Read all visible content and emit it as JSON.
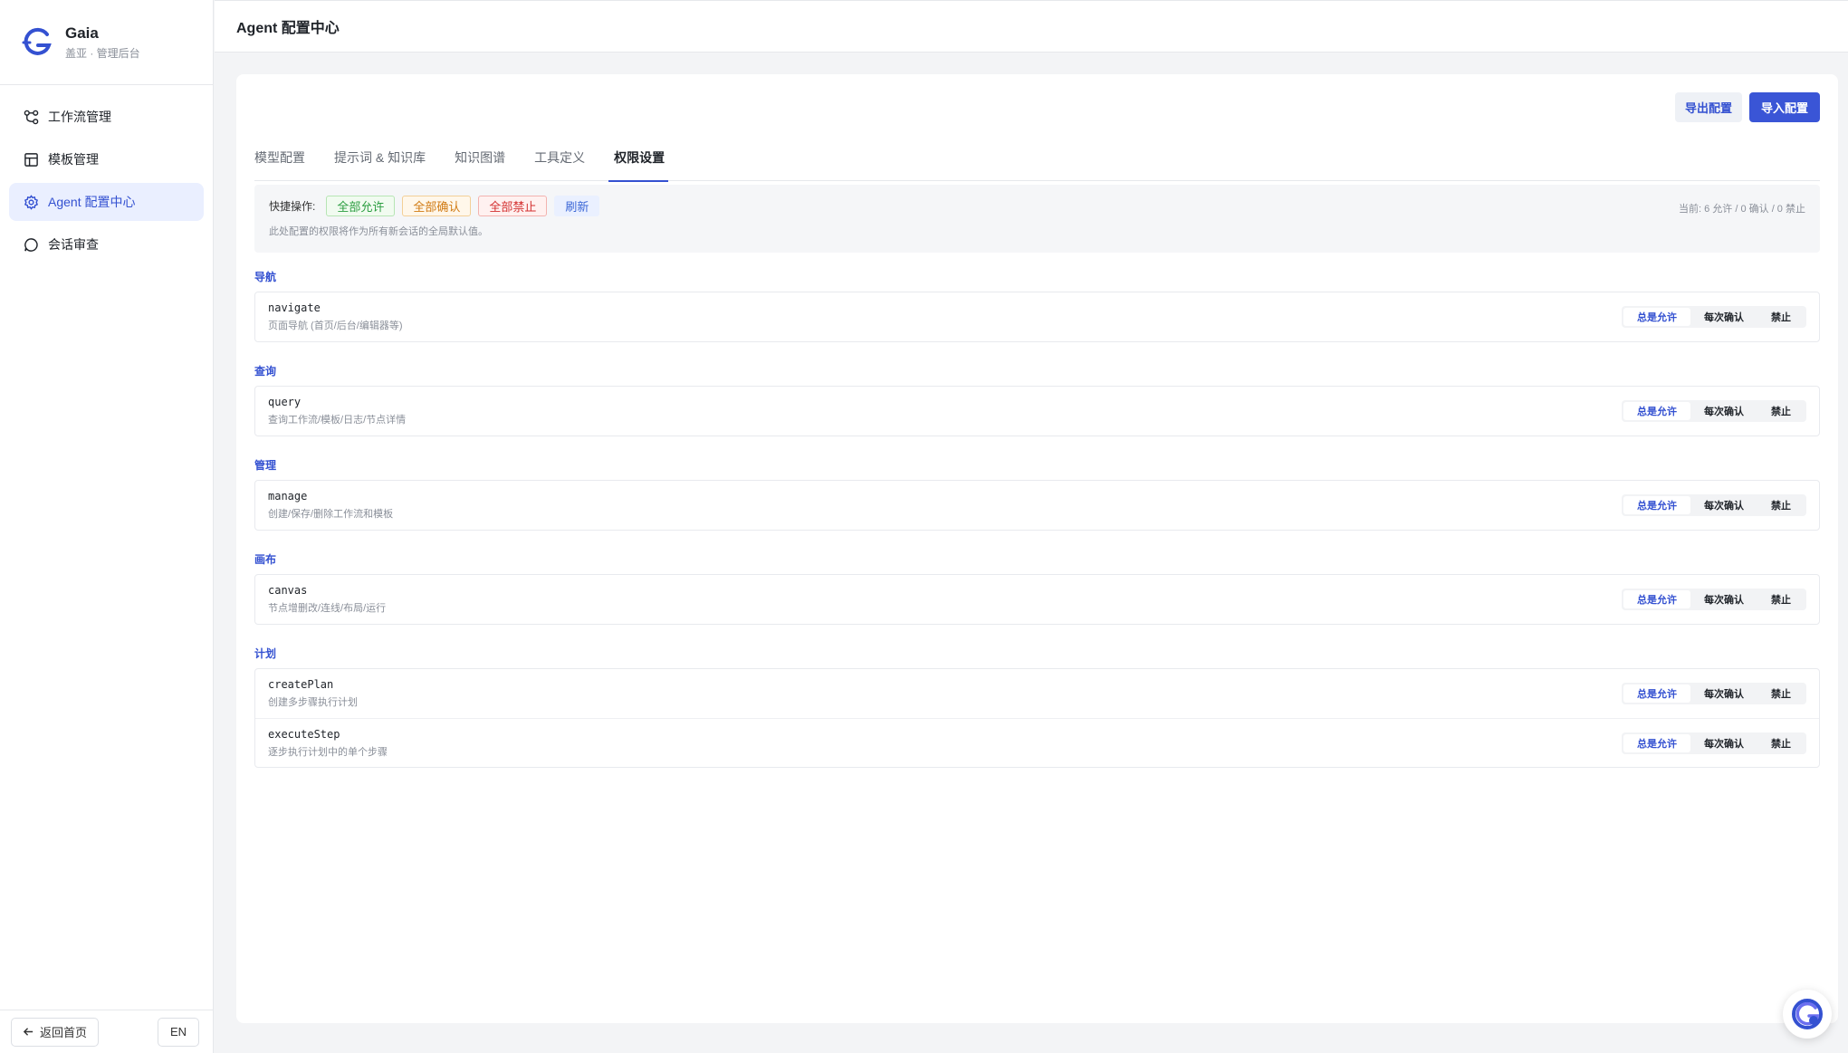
{
  "brand": {
    "name": "Gaia",
    "subtitle": "盖亚 · 管理后台",
    "logo_icon": "gaia-logo-icon"
  },
  "nav": [
    {
      "label": "工作流管理",
      "icon": "workflow-icon",
      "active": false
    },
    {
      "label": "模板管理",
      "icon": "template-icon",
      "active": false
    },
    {
      "label": "Agent 配置中心",
      "icon": "gear-icon",
      "active": true
    },
    {
      "label": "会话审查",
      "icon": "chat-icon",
      "active": false
    }
  ],
  "footer": {
    "back_label": "返回首页",
    "lang_label": "EN"
  },
  "header": {
    "title": "Agent 配置中心"
  },
  "actions": {
    "export_label": "导出配置",
    "import_label": "导入配置"
  },
  "tabs": [
    {
      "label": "模型配置",
      "active": false
    },
    {
      "label": "提示词 & 知识库",
      "active": false
    },
    {
      "label": "知识图谱",
      "active": false
    },
    {
      "label": "工具定义",
      "active": false
    },
    {
      "label": "权限设置",
      "active": true
    }
  ],
  "quick": {
    "label": "快捷操作:",
    "allow_all": "全部允许",
    "confirm_all": "全部确认",
    "deny_all": "全部禁止",
    "refresh": "刷新",
    "stats": "当前: 6 允许 / 0 确认 / 0 禁止",
    "note": "此处配置的权限将作为所有新会话的全局默认值。"
  },
  "options": {
    "allow": "总是允许",
    "confirm": "每次确认",
    "deny": "禁止"
  },
  "groups": [
    {
      "title": "导航",
      "items": [
        {
          "name": "navigate",
          "desc": "页面导航 (首页/后台/编辑器等)",
          "value": "allow"
        }
      ]
    },
    {
      "title": "查询",
      "items": [
        {
          "name": "query",
          "desc": "查询工作流/模板/日志/节点详情",
          "value": "allow"
        }
      ]
    },
    {
      "title": "管理",
      "items": [
        {
          "name": "manage",
          "desc": "创建/保存/删除工作流和模板",
          "value": "allow"
        }
      ]
    },
    {
      "title": "画布",
      "items": [
        {
          "name": "canvas",
          "desc": "节点增删改/连线/布局/运行",
          "value": "allow"
        }
      ]
    },
    {
      "title": "计划",
      "items": [
        {
          "name": "createPlan",
          "desc": "创建多步骤执行计划",
          "value": "allow"
        },
        {
          "name": "executeStep",
          "desc": "逐步执行计划中的单个步骤",
          "value": "allow"
        }
      ]
    }
  ],
  "colors": {
    "accent": "#3451d1",
    "primary_button": "#3a55d6"
  },
  "float_button_icon": "assistant-icon"
}
